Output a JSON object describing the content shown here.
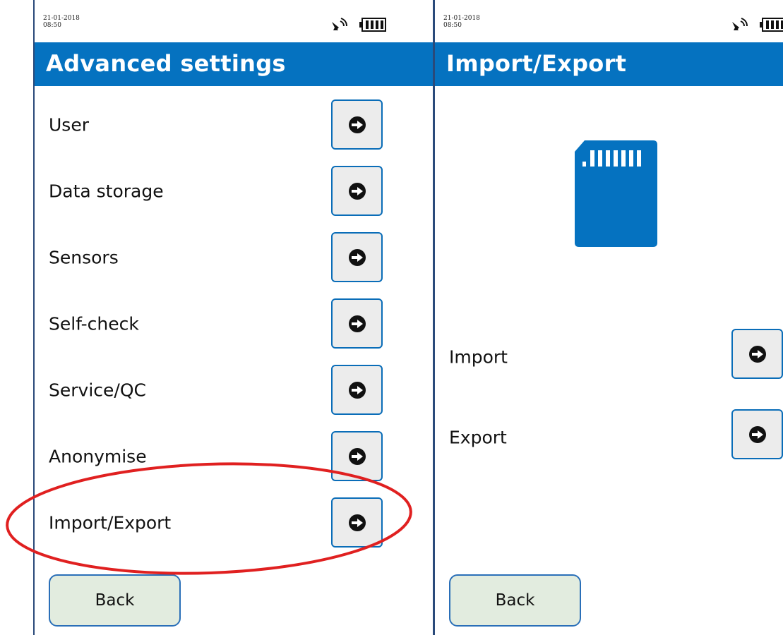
{
  "screens": [
    {
      "datetime": {
        "date": "21-01-2018",
        "time": "08:50"
      },
      "title": "Advanced settings",
      "menu": [
        {
          "label": "User"
        },
        {
          "label": "Data storage"
        },
        {
          "label": "Sensors"
        },
        {
          "label": "Self-check"
        },
        {
          "label": "Service/QC"
        },
        {
          "label": "Anonymise"
        },
        {
          "label": "Import/Export"
        }
      ],
      "back_label": "Back"
    },
    {
      "datetime": {
        "date": "21-01-2018",
        "time": "08:50"
      },
      "title": "Import/Export",
      "illustration_icon": "sd-card-icon",
      "menu": [
        {
          "label": "Import"
        },
        {
          "label": "Export"
        }
      ],
      "back_label": "Back"
    }
  ],
  "annotation": {
    "highlighted_item": "Import/Export",
    "color": "#e02020"
  },
  "colors": {
    "header": "#0572c0",
    "button_border": "#0a6db8",
    "back_button_bg": "#e2ecdf"
  }
}
